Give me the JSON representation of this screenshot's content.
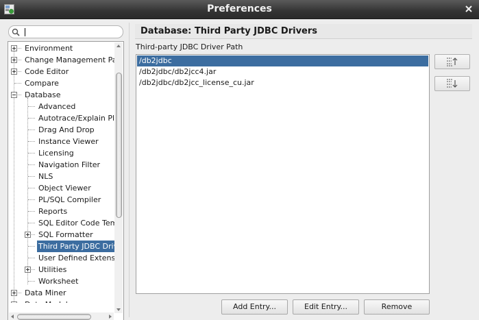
{
  "window": {
    "title": "Preferences"
  },
  "search": {
    "value": "",
    "placeholder": ""
  },
  "tree": {
    "items": [
      {
        "label": "Environment",
        "expander": "plus"
      },
      {
        "label": "Change Management Par",
        "expander": "plus"
      },
      {
        "label": "Code Editor",
        "expander": "plus"
      },
      {
        "label": "Compare",
        "expander": "none"
      },
      {
        "label": "Database",
        "expander": "minus"
      },
      {
        "label": "Advanced",
        "expander": "none"
      },
      {
        "label": "Autotrace/Explain Pl",
        "expander": "none"
      },
      {
        "label": "Drag And Drop",
        "expander": "none"
      },
      {
        "label": "Instance Viewer",
        "expander": "none"
      },
      {
        "label": "Licensing",
        "expander": "none"
      },
      {
        "label": "Navigation Filter",
        "expander": "none"
      },
      {
        "label": "NLS",
        "expander": "none"
      },
      {
        "label": "Object Viewer",
        "expander": "none"
      },
      {
        "label": "PL/SQL Compiler",
        "expander": "none"
      },
      {
        "label": "Reports",
        "expander": "none"
      },
      {
        "label": "SQL Editor Code Tem",
        "expander": "none"
      },
      {
        "label": "SQL Formatter",
        "expander": "plus"
      },
      {
        "label": "Third Party JDBC Driv",
        "expander": "none",
        "selected": true
      },
      {
        "label": "User Defined Extensi",
        "expander": "none"
      },
      {
        "label": "Utilities",
        "expander": "plus"
      },
      {
        "label": "Worksheet",
        "expander": "none"
      },
      {
        "label": "Data Miner",
        "expander": "plus"
      },
      {
        "label": "Data Modeler",
        "expander": "plus"
      }
    ]
  },
  "panel": {
    "title": "Database: Third Party JDBC Drivers",
    "field_label": "Third-party JDBC Driver Path",
    "entries": [
      {
        "path": "/db2jdbc",
        "selected": true
      },
      {
        "path": "/db2jdbc/db2jcc4.jar"
      },
      {
        "path": "/db2jdbc/db2jcc_license_cu.jar"
      }
    ],
    "move_up_icon": "move-up-icon",
    "move_down_icon": "move-down-icon"
  },
  "buttons": {
    "add_entry": "Add Entry...",
    "edit_entry": "Edit Entry...",
    "remove": "Remove"
  },
  "colors": {
    "selection": "#3c6da0",
    "titlebar": "#343434"
  }
}
